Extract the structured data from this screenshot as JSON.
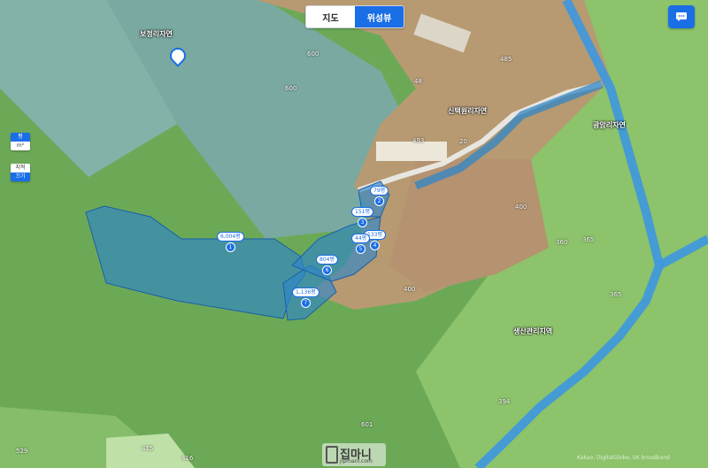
{
  "view_toggle": {
    "map_label": "지도",
    "satellite_label": "위성뷰",
    "active": "satellite"
  },
  "side_controls": {
    "unit": {
      "top": "평",
      "bottom": "m²"
    },
    "toggle": {
      "top": "지적",
      "bottom": "끄기"
    }
  },
  "region_labels": [
    {
      "name": "region-bojeong",
      "text": "보정리자연"
    },
    {
      "name": "region-sintaek",
      "text": "신택원리자연"
    },
    {
      "name": "region-gwangam",
      "text": "광암리자연"
    },
    {
      "name": "region-saengsan",
      "text": "생산관리지역"
    }
  ],
  "parcels": [
    {
      "name": "parcel-1",
      "area": "6,004평",
      "num": "1"
    },
    {
      "name": "parcel-2",
      "area": "79평",
      "num": "2"
    },
    {
      "name": "parcel-3",
      "area": "151평",
      "num": "3"
    },
    {
      "name": "parcel-4",
      "area": "133평",
      "num": "4"
    },
    {
      "name": "parcel-5",
      "area": "44평",
      "num": "5"
    },
    {
      "name": "parcel-6",
      "area": "804평",
      "num": "6"
    },
    {
      "name": "parcel-7",
      "area": "1,136평",
      "num": "7"
    }
  ],
  "lot_numbers": [
    "600",
    "600",
    "493",
    "20",
    "485",
    "48",
    "400",
    "365",
    "400",
    "394",
    "415",
    "416",
    "529",
    "601",
    "360",
    "365"
  ],
  "watermark": {
    "title": "집마니",
    "url": "jipmani.com"
  },
  "copyright": "Kakao, DigitalGlobe, SK broadband",
  "colors": {
    "accent": "#1a6ee6",
    "parcel_fill": "#2f86c8",
    "road": "#4aa0e6"
  }
}
